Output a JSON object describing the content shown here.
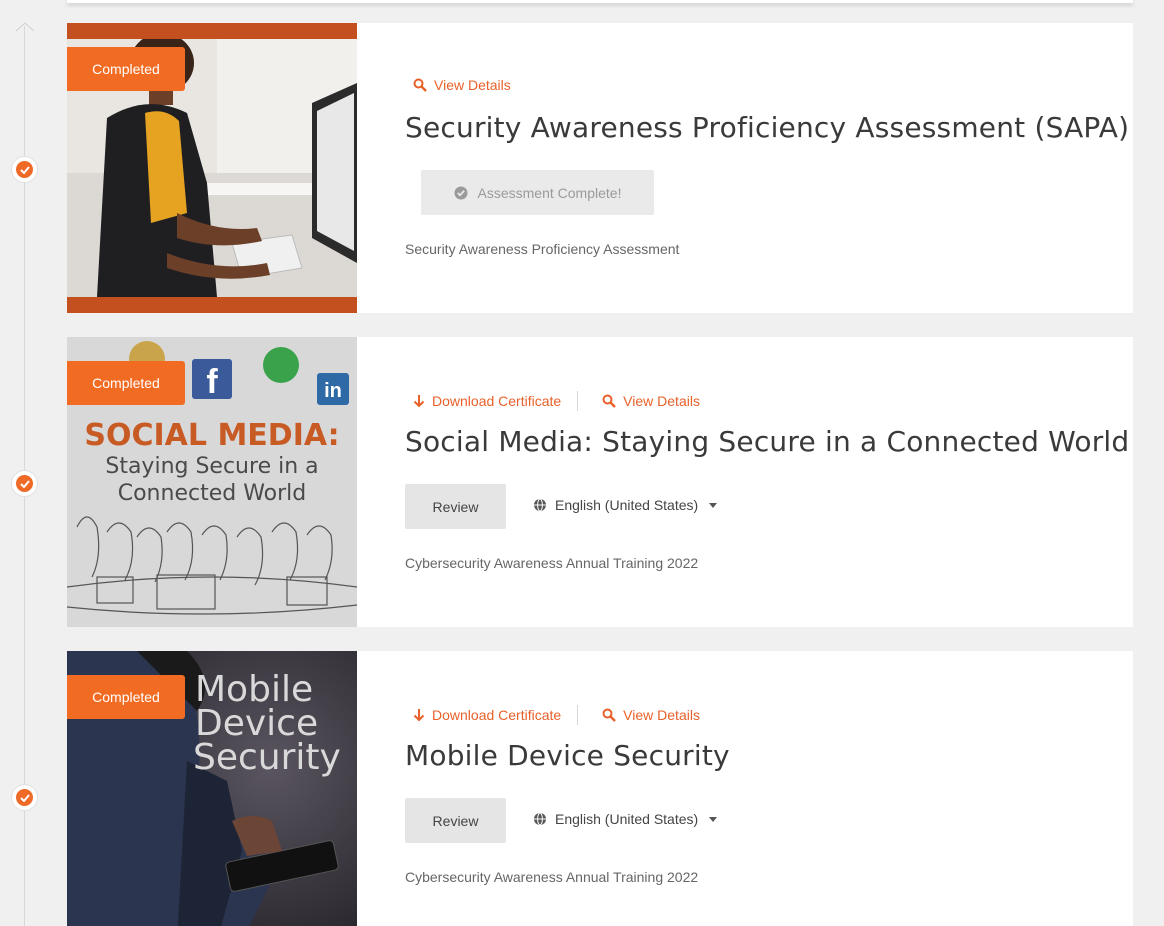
{
  "colors": {
    "accent": "#f26b22",
    "link": "#e8612a"
  },
  "cards": [
    {
      "badge": "Completed",
      "view_details": "View Details",
      "title": "Security Awareness Proficiency Assessment (SAPA)",
      "status_button": "Assessment Complete!",
      "subtitle": "Security Awareness Proficiency Assessment"
    },
    {
      "badge": "Completed",
      "download_certificate": "Download Certificate",
      "view_details": "View Details",
      "thumb_heading": "SOCIAL MEDIA:",
      "thumb_sub1": "Staying Secure in a",
      "thumb_sub2": "Connected World",
      "title": "Social Media: Staying Secure in a Connected World",
      "review_button": "Review",
      "language": "English (United States)",
      "subtitle": "Cybersecurity Awareness Annual Training 2022"
    },
    {
      "badge": "Completed",
      "download_certificate": "Download Certificate",
      "view_details": "View Details",
      "thumb_line1": "Mobile",
      "thumb_line2": "Device",
      "thumb_line3": "Security",
      "title": "Mobile Device Security",
      "review_button": "Review",
      "language": "English (United States)",
      "subtitle": "Cybersecurity Awareness Annual Training 2022"
    }
  ]
}
